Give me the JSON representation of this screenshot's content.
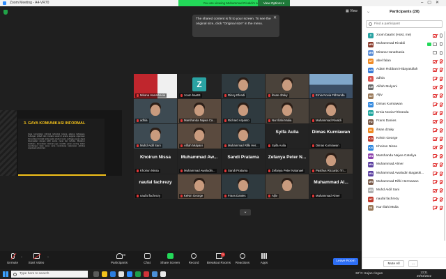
{
  "window": {
    "title": "Zoom Meeting - A4-VR70"
  },
  "banner": {
    "text": "You are viewing Muhammad Rivaldi's screen",
    "view_options": "View Options ▾"
  },
  "view_button": "▦ View",
  "notice": {
    "text": "The shared content is fit to your screen. To see the original size, click \"Original size\" in the menu."
  },
  "slide": {
    "title": "3. GAYA KOMUNIKASI INFORMAL",
    "body": "Gaya komunikasi informal terbentuk karena adanya kebiasaan, hubungan pribadi dan interaksi sosial di antara anggota organisasi. Komunikasi ini tidak terikat pada struktur resmi, sehingga pesan dapat disampaikan dengan lebih santai, cepat dan terbuka. Meskipun demikian, komunikasi informal juga memiliki peran penting dalam membangun kerja sama serta mendukung kelancaran aktivitas organisasi sehari-hari."
  },
  "tiles": [
    {
      "name": "Mirana Hanathasia",
      "kind": "banner"
    },
    {
      "name": "zoom baa04",
      "kind": "zoom",
      "initial": "Z"
    },
    {
      "name": "Rinny Efendi",
      "kind": "photo"
    },
    {
      "name": "ihsan dzaky",
      "kind": "photo"
    },
    {
      "name": "Ernia Novia Fithranda",
      "kind": "city"
    },
    {
      "name": "adhia",
      "kind": "photo"
    },
    {
      "name": "Marshanda Najwa Ca...",
      "kind": "photo"
    },
    {
      "name": "Richard Arpanto",
      "kind": "photo"
    },
    {
      "name": "Nur Illahi Mulia",
      "kind": "photo"
    },
    {
      "name": "Muhammad Rivaldi",
      "kind": "photo"
    },
    {
      "name": "Muhd Aidil Sani",
      "kind": "photo"
    },
    {
      "name": "Alifah Mulyani",
      "kind": "photo"
    },
    {
      "name": "Muhammad Rifki Her...",
      "kind": "photo"
    },
    {
      "name": "Syifa Aulia",
      "kind": "text",
      "big": "Syifa Aulia"
    },
    {
      "name": "Dimas Kurniawan",
      "kind": "text",
      "big": "Dimas Kurniawan"
    },
    {
      "name": "Khoirun Nissa",
      "kind": "text",
      "big": "Khoirun Nissa"
    },
    {
      "name": "Muhammad Awaludin...",
      "kind": "text",
      "big": "Muhammad Aw..."
    },
    {
      "name": "Sandi Pratama",
      "kind": "text",
      "big": "Sandi Pratama"
    },
    {
      "name": "Zefanya Peter Natanael",
      "kind": "text",
      "big": "Zefanya Peter N..."
    },
    {
      "name": "Pasthus Riccardo Tri...",
      "kind": "photo"
    },
    {
      "name": "naufal fachrezy",
      "kind": "text",
      "big": "naufal fachrezy"
    },
    {
      "name": "Kelvin George",
      "kind": "photo"
    },
    {
      "name": "Frans Danies",
      "kind": "photo"
    },
    {
      "name": "Aljiv",
      "kind": "photo"
    },
    {
      "name": "Muhammad Almer",
      "kind": "text",
      "big": "Muhammad Al..."
    }
  ],
  "gallery_more": "⌄",
  "participants": {
    "title": "Participants (28)",
    "search_placeholder": "Find a participant",
    "list": [
      {
        "name": "zoom baa04 (Host, me)",
        "initial": "Z",
        "color": "#2aa3a3",
        "mic": "on",
        "cam": "off"
      },
      {
        "name": "Muhammad Rivaldi",
        "initial": "MR",
        "color": "#8b3a2a",
        "mic": "on",
        "cam": "on",
        "share": true
      },
      {
        "name": "Mirana Hanathasia",
        "initial": "MH",
        "color": "#5b8dd6",
        "mic": "on",
        "cam": "on"
      },
      {
        "name": "abel falan",
        "initial": "AF",
        "color": "#f08a24",
        "mic": "off",
        "cam": "off"
      },
      {
        "name": "Adam Robbani Hidayatullah",
        "initial": "AR",
        "color": "#3b7dd8",
        "mic": "off",
        "cam": "off"
      },
      {
        "name": "adhia",
        "initial": "A",
        "color": "#d9534f",
        "mic": "off",
        "cam": "off"
      },
      {
        "name": "Alifah Mulyani",
        "initial": "AM",
        "color": "#6b6b6b",
        "mic": "off",
        "cam": "off"
      },
      {
        "name": "Aljiv",
        "initial": "AJ",
        "color": "#9b7b5b",
        "mic": "off",
        "cam": "off"
      },
      {
        "name": "Dimas Kurniawan",
        "initial": "DK",
        "color": "#2e86de",
        "mic": "off",
        "cam": "off"
      },
      {
        "name": "Ernia Novia Fithranda",
        "initial": "EN",
        "color": "#1aa39a",
        "mic": "off",
        "cam": "off"
      },
      {
        "name": "Frans Danies",
        "initial": "FD",
        "color": "#7a5a48",
        "mic": "off",
        "cam": "off"
      },
      {
        "name": "ihsan dzaky",
        "initial": "ID",
        "color": "#f08a24",
        "mic": "off",
        "cam": "off"
      },
      {
        "name": "Kelvin George",
        "initial": "KG",
        "color": "#c0392b",
        "mic": "off",
        "cam": "off"
      },
      {
        "name": "Khoirun Nissa",
        "initial": "KN",
        "color": "#2e86de",
        "mic": "off",
        "cam": "off"
      },
      {
        "name": "Marshanda Najwa Cateliya",
        "initial": "MN",
        "color": "#8e44ad",
        "mic": "off",
        "cam": "off"
      },
      {
        "name": "Muhammad Almer",
        "initial": "MA",
        "color": "#5b3fa0",
        "mic": "off",
        "cam": "off"
      },
      {
        "name": "Muhammad Awaludin Bagaski...",
        "initial": "MA",
        "color": "#5b3fa0",
        "mic": "off",
        "cam": "off"
      },
      {
        "name": "Muhammad Rifki Hermawan",
        "initial": "MR",
        "color": "#7a5a48",
        "mic": "off",
        "cam": "off"
      },
      {
        "name": "Muhd Aidil Sani",
        "initial": "MS",
        "color": "#b0b0b0",
        "mic": "off",
        "cam": "off"
      },
      {
        "name": "naufal fachrezy",
        "initial": "NF",
        "color": "#c0392b",
        "mic": "off",
        "cam": "off"
      },
      {
        "name": "Nur Illahi Mulia",
        "initial": "NI",
        "color": "#9b7b5b",
        "mic": "off",
        "cam": "off"
      }
    ],
    "mute_all": "Mute All",
    "more": "..."
  },
  "toolbar": {
    "unmute": "Unmute",
    "start_video": "Start Video",
    "participants": "Participants",
    "participants_count": "28",
    "chat": "Chat",
    "share_screen": "Share Screen",
    "record": "Record",
    "breakout_rooms": "Breakout Rooms",
    "breakout_badge": "1",
    "reactions": "Reactions",
    "apps": "Apps",
    "leave": "Leave Room"
  },
  "taskbar": {
    "search": "Type here to search",
    "weather": "32°C  Hujan ringan",
    "time": "13:31",
    "date": "29/03/2022"
  }
}
